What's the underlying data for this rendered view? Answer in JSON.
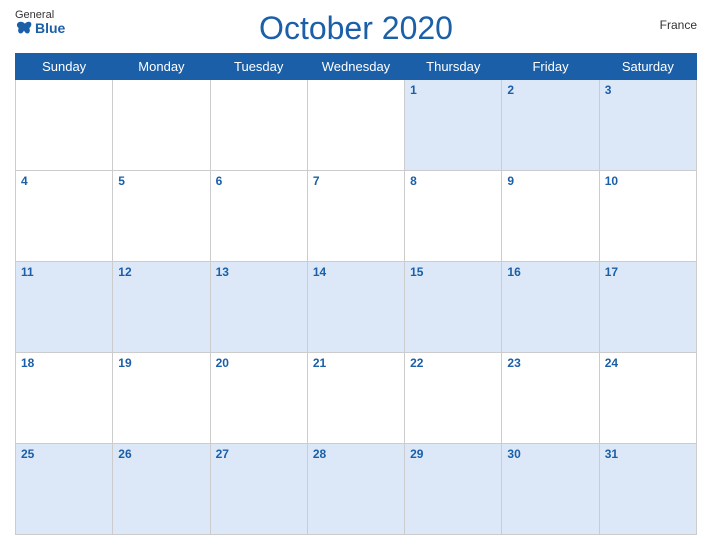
{
  "header": {
    "logo": {
      "general": "General",
      "blue": "Blue"
    },
    "title": "October 2020",
    "country": "France"
  },
  "weekdays": [
    "Sunday",
    "Monday",
    "Tuesday",
    "Wednesday",
    "Thursday",
    "Friday",
    "Saturday"
  ],
  "weeks": [
    [
      null,
      null,
      null,
      null,
      1,
      2,
      3
    ],
    [
      4,
      5,
      6,
      7,
      8,
      9,
      10
    ],
    [
      11,
      12,
      13,
      14,
      15,
      16,
      17
    ],
    [
      18,
      19,
      20,
      21,
      22,
      23,
      24
    ],
    [
      25,
      26,
      27,
      28,
      29,
      30,
      31
    ]
  ],
  "colors": {
    "primary": "#1a5fa8",
    "rowOdd": "#dce8f7",
    "rowEven": "#ffffff"
  }
}
